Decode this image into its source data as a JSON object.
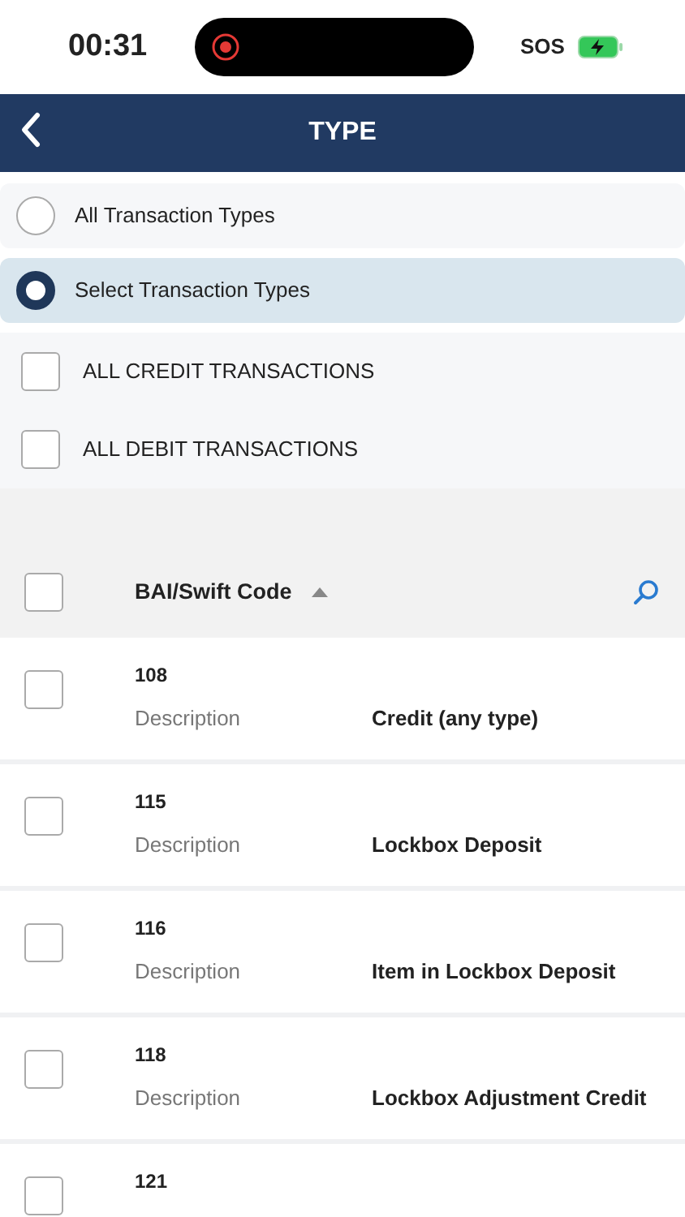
{
  "status_bar": {
    "time": "00:31",
    "sos": "SOS"
  },
  "header": {
    "title": "TYPE"
  },
  "options": [
    {
      "label": "All Transaction Types",
      "selected": false
    },
    {
      "label": "Select Transaction Types",
      "selected": true
    }
  ],
  "groups": [
    {
      "label": "ALL CREDIT TRANSACTIONS",
      "checked": false
    },
    {
      "label": "ALL DEBIT TRANSACTIONS",
      "checked": false
    }
  ],
  "table": {
    "select_all": {
      "checked": false
    },
    "column": "BAI/Swift Code",
    "sort_ascending": true,
    "rows": [
      {
        "code": "108",
        "label": "Description",
        "description": "Credit (any type)",
        "checked": false
      },
      {
        "code": "115",
        "label": "Description",
        "description": "Lockbox Deposit",
        "checked": false
      },
      {
        "code": "116",
        "label": "Description",
        "description": "Item in Lockbox Deposit",
        "checked": false
      },
      {
        "code": "118",
        "label": "Description",
        "description": "Lockbox Adjustment Credit",
        "checked": false
      },
      {
        "code": "121",
        "checked": false
      }
    ]
  }
}
